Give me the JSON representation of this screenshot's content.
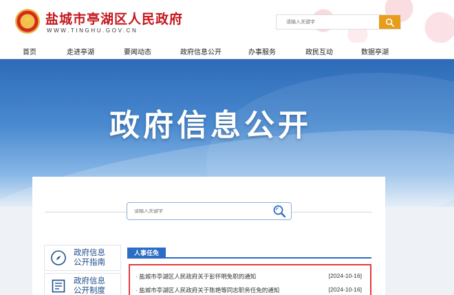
{
  "header": {
    "title": "盐城市亭湖区人民政府",
    "domain": "WWW.TINGHU.GOV.CN",
    "search_placeholder": "请输入关键字"
  },
  "nav": {
    "items": [
      "首页",
      "走进亭湖",
      "要闻动态",
      "政府信息公开",
      "办事服务",
      "政民互动",
      "数据亭湖"
    ]
  },
  "banner": {
    "title": "政府信息公开"
  },
  "content_search": {
    "placeholder": "请输入关键字"
  },
  "sidebar": {
    "items": [
      {
        "line1": "政府信息",
        "line2": "公开指南",
        "icon": "compass-icon"
      },
      {
        "line1": "政府信息",
        "line2": "公开制度",
        "icon": "document-icon"
      }
    ]
  },
  "section": {
    "tab_label": "人事任免",
    "items": [
      {
        "title": "· 盐城市亭湖区人民政府关于彭怀明免职的通知",
        "date": "[2024-10-16]"
      },
      {
        "title": "· 盐城市亭湖区人民政府关于陈艳等同志职务任免的通知",
        "date": "[2024-10-16]"
      }
    ]
  },
  "colors": {
    "brand_red": "#c4161c",
    "accent_blue": "#2b6cc4",
    "search_orange": "#e79c1b",
    "highlight_red": "#e23a3a"
  }
}
